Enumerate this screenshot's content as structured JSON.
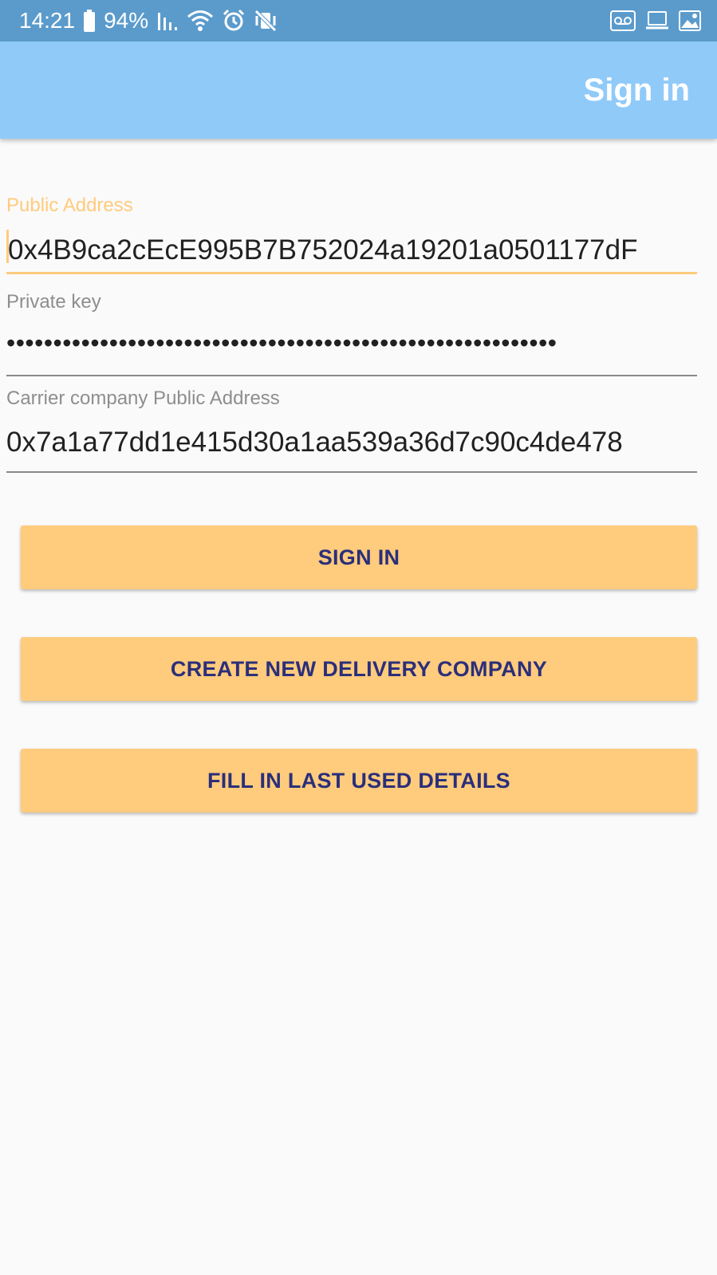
{
  "status_bar": {
    "time": "14:21",
    "battery": "94%",
    "left_icons": [
      "battery-icon",
      "signal-icon",
      "wifi-icon",
      "alarm-icon",
      "vibrate-mute-icon"
    ],
    "right_icons": [
      "voicemail-icon",
      "laptop-icon",
      "image-icon"
    ]
  },
  "app_bar": {
    "title": "Sign in"
  },
  "form": {
    "public_address": {
      "label": "Public Address",
      "value": "0x4B9ca2cEcE995B7B752024a19201a0501177dF"
    },
    "private_key": {
      "label": "Private key",
      "value": "•••••••••••••••••••••••••••••••••••••••••••••••••••••••••••"
    },
    "carrier_address": {
      "label": "Carrier company Public Address",
      "value": "0x7a1a77dd1e415d30a1aa539a36d7c90c4de478"
    }
  },
  "buttons": {
    "sign_in": "SIGN IN",
    "create_company": "CREATE NEW DELIVERY COMPANY",
    "fill_last": "FILL IN LAST USED DETAILS"
  },
  "colors": {
    "status_bar": "#5b9bcb",
    "app_bar": "#90caf9",
    "accent": "#ffcb7d",
    "button_text": "#2b2f7a"
  }
}
